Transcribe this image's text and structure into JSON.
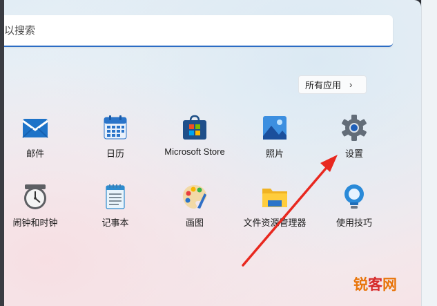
{
  "search": {
    "placeholder": "以搜索"
  },
  "all_apps": {
    "label": "所有应用",
    "chevron": "›"
  },
  "pinned_row1": [
    {
      "label": "邮件",
      "icon": "mail-icon"
    },
    {
      "label": "日历",
      "icon": "calendar-icon"
    },
    {
      "label": "Microsoft Store",
      "icon": "store-icon"
    },
    {
      "label": "照片",
      "icon": "photos-icon"
    },
    {
      "label": "设置",
      "icon": "settings-gear-icon"
    }
  ],
  "pinned_row2": [
    {
      "label": "闹钟和时钟",
      "icon": "alarm-clock-icon"
    },
    {
      "label": "记事本",
      "icon": "notepad-icon"
    },
    {
      "label": "画图",
      "icon": "paint-palette-icon"
    },
    {
      "label": "文件资源管理器",
      "icon": "folder-icon"
    },
    {
      "label": "使用技巧",
      "icon": "tips-lightbulb-icon"
    }
  ],
  "watermark": {
    "part1": "锐",
    "part2": "客",
    "part3": "网"
  },
  "colors": {
    "accent": "#2b6cc4",
    "arrow": "#e8281f"
  }
}
